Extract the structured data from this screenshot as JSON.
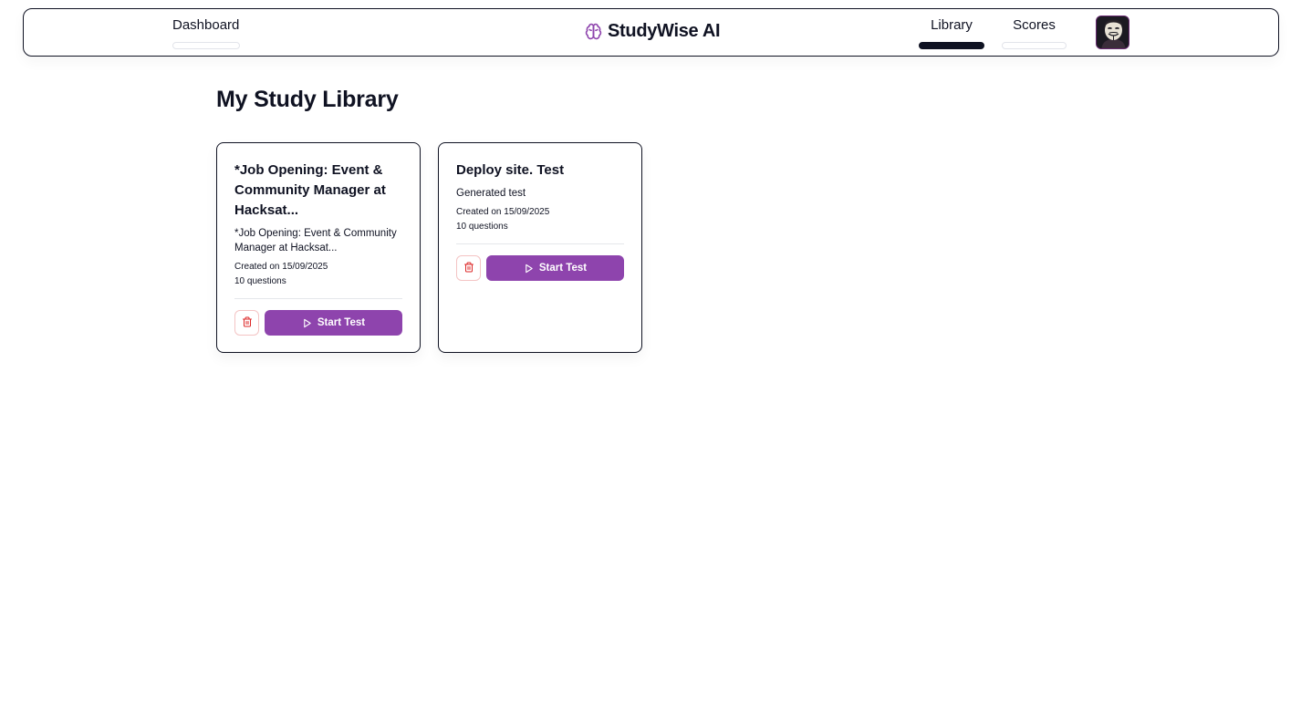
{
  "header": {
    "dashboard_label": "Dashboard",
    "brand_name": "StudyWise AI",
    "nav": [
      {
        "label": "Library",
        "active": true
      },
      {
        "label": "Scores",
        "active": false
      }
    ],
    "avatar_icon": "anonymous-mask-avatar",
    "brand_icon": "brain-icon",
    "brand_color": "#8e44ad"
  },
  "main": {
    "title": "My Study Library",
    "cards": [
      {
        "title": "*Job Opening: Event & Community Manager at Hacksat...",
        "description": "*Job Opening: Event & Community Manager at Hacksat...",
        "created": "Created on 15/09/2025",
        "questions": "10 questions",
        "start_label": "Start Test",
        "delete_icon": "trash-icon"
      },
      {
        "title": "Deploy site. Test",
        "description": "Generated test",
        "created": "Created on 15/09/2025",
        "questions": "10 questions",
        "start_label": "Start Test",
        "delete_icon": "trash-icon"
      }
    ]
  },
  "colors": {
    "accent": "#8e44ad",
    "text": "#0f1222",
    "danger": "#dc2626"
  }
}
